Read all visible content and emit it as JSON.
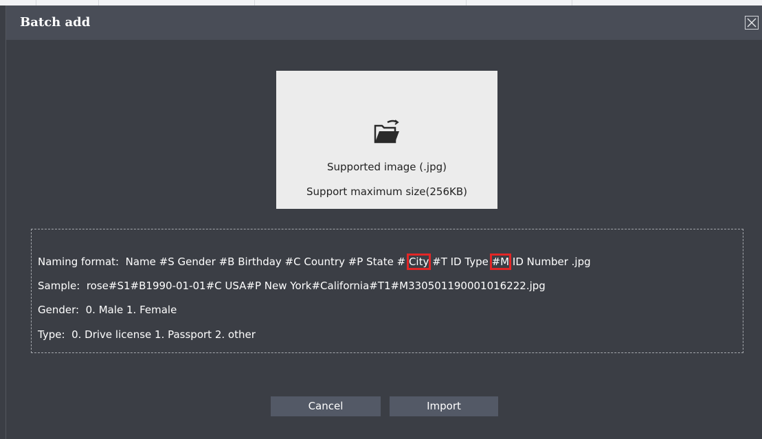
{
  "dialog": {
    "title": "Batch add",
    "close_icon": "close-icon"
  },
  "upload": {
    "icon": "folder-open-icon",
    "supported_text": "Supported image (.jpg)",
    "max_size_text": "Support maximum size(256KB)"
  },
  "info": {
    "naming_label": "Naming format:",
    "naming_before_city": "Name #S Gender #B Birthday #C Country #P State #",
    "naming_city": "City",
    "naming_mid": "#T ID Type ",
    "naming_m": "#M",
    "naming_after": "ID Number .jpg",
    "sample_label": "Sample:",
    "sample_value": "rose#S1#B1990-01-01#C USA#P New York#California#T1#M330501190001016222.jpg",
    "gender_label": "Gender:",
    "gender_value": "0. Male 1. Female",
    "type_label": "Type:",
    "type_value": "0. Drive license 1. Passport 2. other",
    "highlight_color": "#e32626"
  },
  "buttons": {
    "cancel_label": "Cancel",
    "import_label": "Import"
  },
  "colors": {
    "dialog_bg": "#3b3e45",
    "titlebar_bg": "#494d57",
    "button_bg": "#535966",
    "drop_zone_bg": "#ececec"
  }
}
